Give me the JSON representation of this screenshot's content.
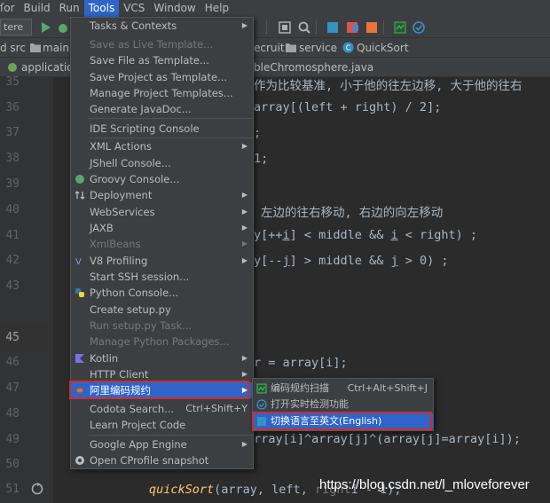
{
  "menubar": {
    "items": [
      "ſor",
      "Build",
      "Run",
      "Tools",
      "VCS",
      "Window",
      "Help"
    ],
    "active": "Tools"
  },
  "toolbar": {
    "run_config": "tere"
  },
  "navbar": {
    "crumbs": [
      "d src",
      "main",
      "ecruit",
      "service",
      "QuickSort"
    ]
  },
  "tabs": {
    "left_tab": "application",
    "right_tab": "bleChromosphere.java"
  },
  "editor": {
    "line_numbers": [
      "35",
      "36",
      "37",
      "38",
      "39",
      "40",
      "41",
      "42",
      "43",
      "45",
      "46",
      "47",
      "48",
      "49",
      "50",
      "51"
    ],
    "lines": {
      "l35": "作为比较基准, 小于他的往左边移, 大于他的往右",
      "l36": "array[(left + right) / 2];",
      "l37": ";",
      "l38": "1;",
      "l40": "左边的往右移动, 右边的向左移动",
      "l41a": "y[++",
      "l41b": "i",
      "l41c": "] < middle && ",
      "l41d": "i",
      "l41e": " < right) ;",
      "l42a": "y[--",
      "l42b": "j",
      "l42c": "] > middle && ",
      "l42d": "j",
      "l42e": " > 0) ;",
      "l46a": "r = array[i];",
      "l49": "array[i]^array[j]^(array[j]=array[i]);",
      "l51a": "quickSort",
      "l51b": "(array, left, ",
      "l51c": "right",
      "l51d": "i - 1);"
    }
  },
  "tools_menu": {
    "items": [
      {
        "label": "Tasks & Contexts",
        "submenu": true
      },
      {
        "label": "Save as Live Template...",
        "disabled": true
      },
      {
        "label": "Save File as Template..."
      },
      {
        "label": "Save Project as Template..."
      },
      {
        "label": "Manage Project Templates..."
      },
      {
        "label": "Generate JavaDoc..."
      },
      {
        "label": "IDE Scripting Console"
      },
      {
        "label": "XML Actions",
        "submenu": true
      },
      {
        "label": "JShell Console..."
      },
      {
        "label": "Groovy Console..."
      },
      {
        "label": "Deployment",
        "submenu": true
      },
      {
        "label": "WebServices",
        "submenu": true
      },
      {
        "label": "JAXB",
        "submenu": true
      },
      {
        "label": "XmlBeans",
        "submenu": true,
        "disabled": true
      },
      {
        "label": "V8 Profiling",
        "submenu": true
      },
      {
        "label": "Start SSH session..."
      },
      {
        "label": "Python Console..."
      },
      {
        "label": "Create setup.py"
      },
      {
        "label": "Run setup.py Task...",
        "disabled": true
      },
      {
        "label": "Manage Python Packages...",
        "disabled": true
      },
      {
        "label": "Kotlin",
        "submenu": true
      },
      {
        "label": "HTTP Client",
        "submenu": true
      },
      {
        "label": "阿里编码规约",
        "submenu": true,
        "selected": true
      },
      {
        "label": "Codota Search...",
        "shortcut": "Ctrl+Shift+Y"
      },
      {
        "label": "Learn Project Code"
      },
      {
        "label": "Google App Engine",
        "submenu": true
      },
      {
        "label": "Open CProfile snapshot"
      }
    ]
  },
  "ali_submenu": {
    "items": [
      {
        "label": "编码规约扫描",
        "shortcut": "Ctrl+Alt+Shift+J"
      },
      {
        "label": "打开实时检测功能"
      },
      {
        "label": "切换语言至英文(English)",
        "selected": true
      }
    ]
  },
  "watermark": "https://blog.csdn.net/l_mloveforever",
  "colors": {
    "menu_bg": "#3c3f41",
    "selection": "#2f65ca",
    "highlight_border": "#d12b2b",
    "editor_bg": "#2b2b2b"
  }
}
